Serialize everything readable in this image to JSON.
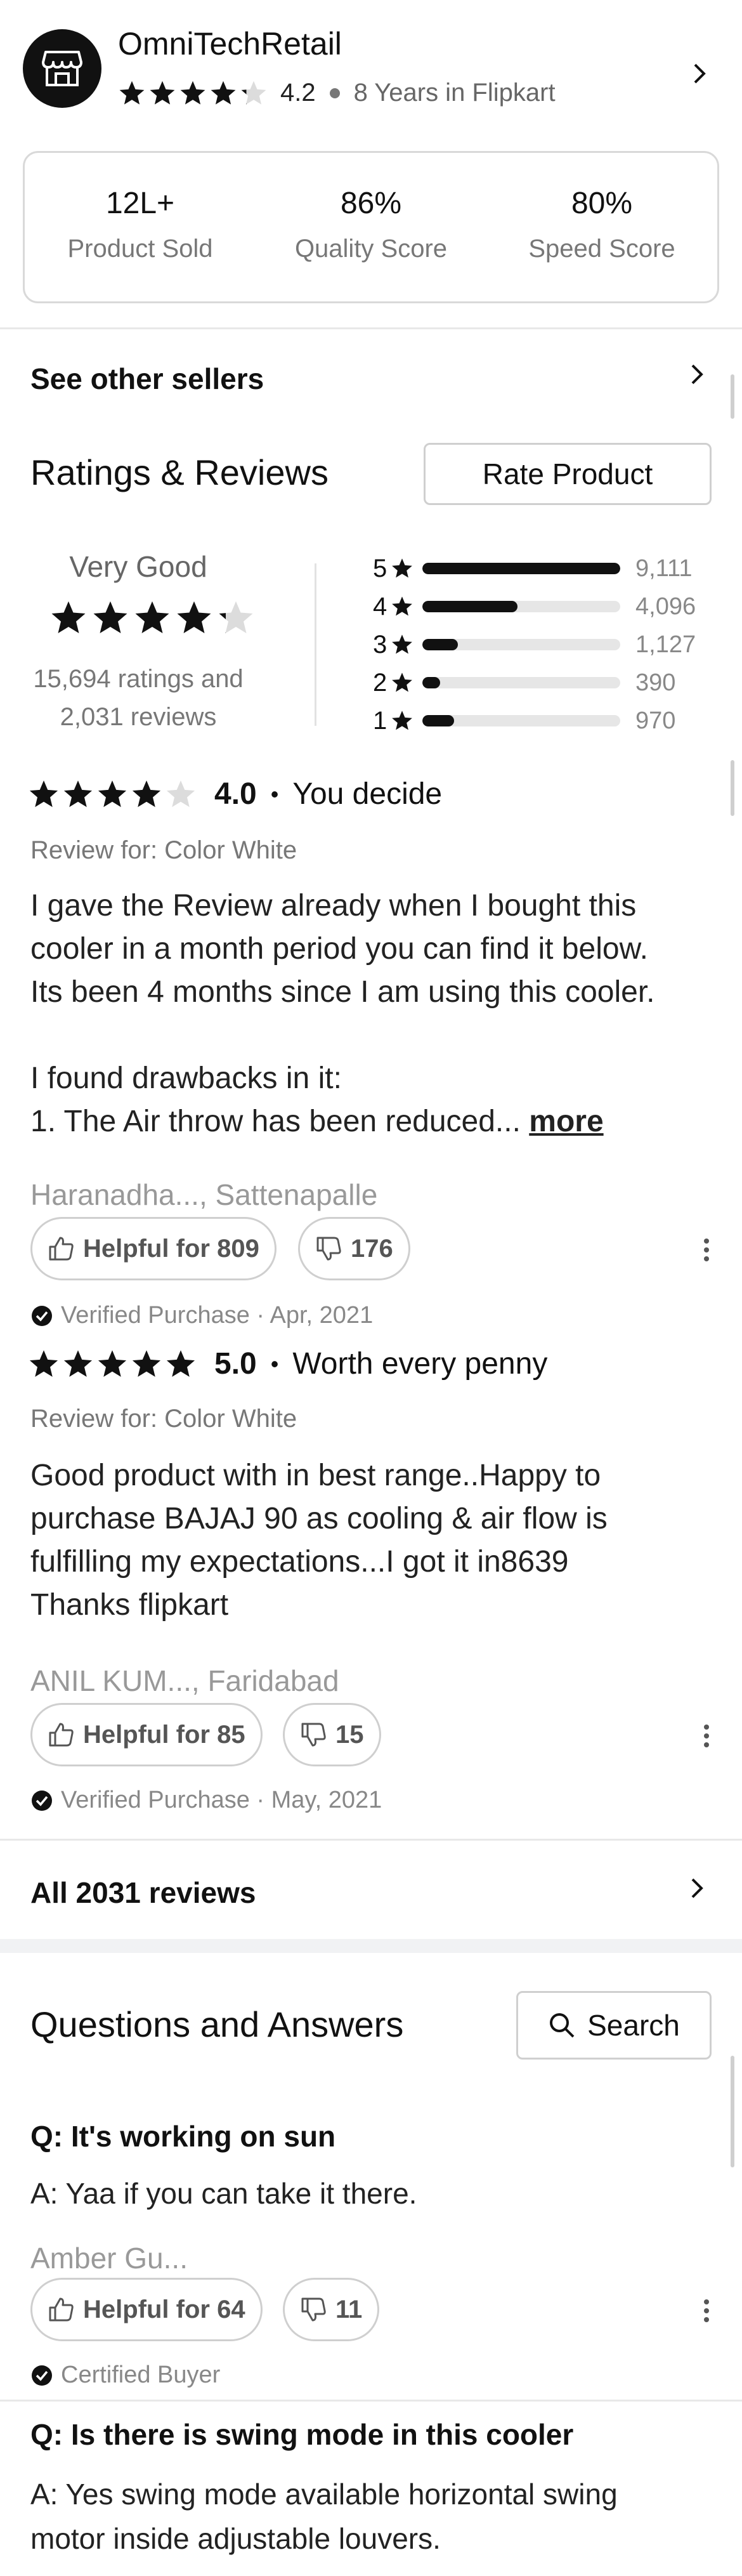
{
  "seller": {
    "name": "OmniTechRetail",
    "rating": "4.2",
    "rating_value": 4.2,
    "tenure": "8 Years in Flipkart",
    "stats": [
      {
        "value": "12L+",
        "label": "Product Sold"
      },
      {
        "value": "86%",
        "label": "Quality Score"
      },
      {
        "value": "80%",
        "label": "Speed Score"
      }
    ]
  },
  "other_sellers": {
    "label": "See other sellers"
  },
  "ratings": {
    "title": "Ratings & Reviews",
    "rate_button": "Rate Product",
    "summary_label": "Very Good",
    "summary_stars": 4.2,
    "ratings_count": "15,694 ratings and",
    "reviews_count": "2,031 reviews",
    "distribution": [
      {
        "stars": "5",
        "count": "9,111",
        "fraction": 1.0
      },
      {
        "stars": "4",
        "count": "4,096",
        "fraction": 0.48
      },
      {
        "stars": "3",
        "count": "1,127",
        "fraction": 0.18
      },
      {
        "stars": "2",
        "count": "390",
        "fraction": 0.09
      },
      {
        "stars": "1",
        "count": "970",
        "fraction": 0.16
      }
    ]
  },
  "reviews": [
    {
      "stars": 4,
      "score": "4.0",
      "headline": "You decide",
      "review_for": "Review for: Color White",
      "body_lines": [
        "I gave the Review already when I bought this",
        "cooler in a month period you can find it below.",
        "Its been 4 months since I am using this cooler.",
        "",
        "I found drawbacks in it:",
        "1. The Air throw has been reduced..."
      ],
      "more": "more",
      "reviewer": "Haranadha..., Sattenapalle",
      "helpful": "Helpful for 809",
      "dislikes": "176",
      "verified": "Verified Purchase · Apr, 2021"
    },
    {
      "stars": 5,
      "score": "5.0",
      "headline": "Worth every penny",
      "review_for": "Review for: Color White",
      "body_lines": [
        "Good product with in best range..Happy to",
        "purchase BAJAJ 90 as cooling & air flow is",
        "fulfilling my expectations...I got it in8639",
        "Thanks flipkart"
      ],
      "reviewer": "ANIL KUM..., Faridabad",
      "helpful": "Helpful for 85",
      "dislikes": "15",
      "verified": "Verified Purchase · May, 2021"
    }
  ],
  "all_reviews": {
    "label": "All 2031 reviews"
  },
  "qa": {
    "title": "Questions and Answers",
    "search_label": "Search",
    "items": [
      {
        "question": "Q: It's working on sun",
        "answer_lines": [
          "A: Yaa if you can take it there."
        ],
        "author": "Amber Gu...",
        "helpful": "Helpful for 64",
        "dislikes": "11",
        "badge": "Certified Buyer"
      },
      {
        "question": "Q: Is there is swing mode in this cooler",
        "answer_lines": [
          "A: Yes swing mode available horizontal swing",
          "motor inside adjustable louvers."
        ]
      }
    ]
  },
  "colors": {
    "text": "#111111",
    "muted": "#777777",
    "border": "#cfcfcf",
    "bar_fill": "#111111",
    "bar_track": "#e6e6e6"
  }
}
